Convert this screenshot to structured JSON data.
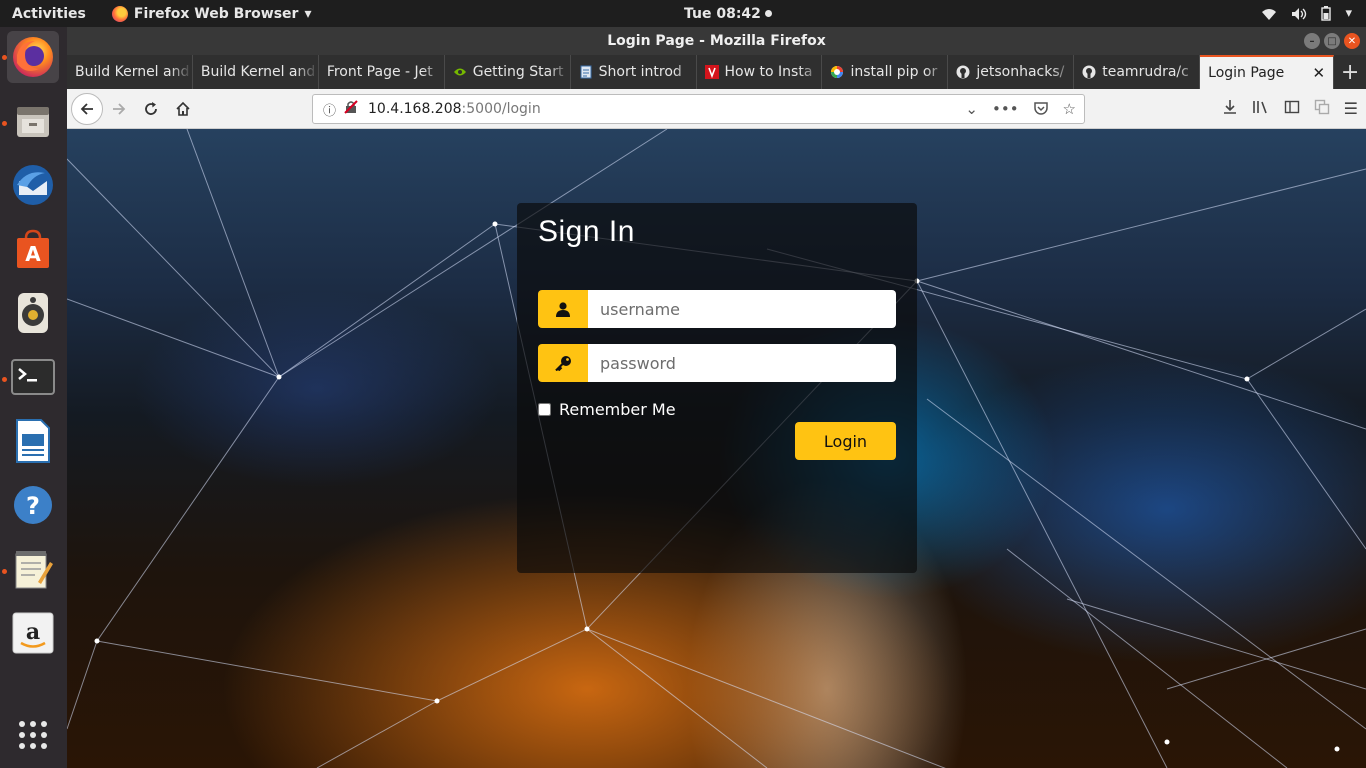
{
  "topbar": {
    "activities": "Activities",
    "app_menu": "Firefox Web Browser",
    "clock": "Tue 08:42",
    "tray_icons": [
      "wifi-icon",
      "volume-icon",
      "battery-icon",
      "power-menu-icon"
    ]
  },
  "dock": {
    "items": [
      "firefox",
      "files",
      "thunderbird",
      "ubuntu-software",
      "rhythmbox",
      "terminal",
      "libreoffice-writer",
      "help",
      "text-editor",
      "amazon",
      "show-applications"
    ],
    "accent": "#e95420"
  },
  "window": {
    "title": "Login Page - Mozilla Firefox"
  },
  "tabs": [
    {
      "label": "Build Kernel and",
      "icon": "none"
    },
    {
      "label": "Build Kernel and",
      "icon": "none"
    },
    {
      "label": "Front Page - Jet",
      "icon": "none"
    },
    {
      "label": "Getting Start",
      "icon": "nvidia-icon"
    },
    {
      "label": "Short introd",
      "icon": "doc-icon"
    },
    {
      "label": "How to Insta",
      "icon": "site-icon"
    },
    {
      "label": "install pip or",
      "icon": "google-icon"
    },
    {
      "label": "jetsonhacks/",
      "icon": "github-icon"
    },
    {
      "label": "teamrudra/c",
      "icon": "github-icon"
    },
    {
      "label": "Login Page",
      "icon": "none",
      "active": true
    }
  ],
  "navbar": {
    "url_host": "10.4.168.208",
    "url_path": ":5000/login"
  },
  "login": {
    "title": "Sign In",
    "username_placeholder": "username",
    "password_placeholder": "password",
    "remember_label": "Remember Me",
    "login_label": "Login",
    "accent": "#ffc312"
  }
}
